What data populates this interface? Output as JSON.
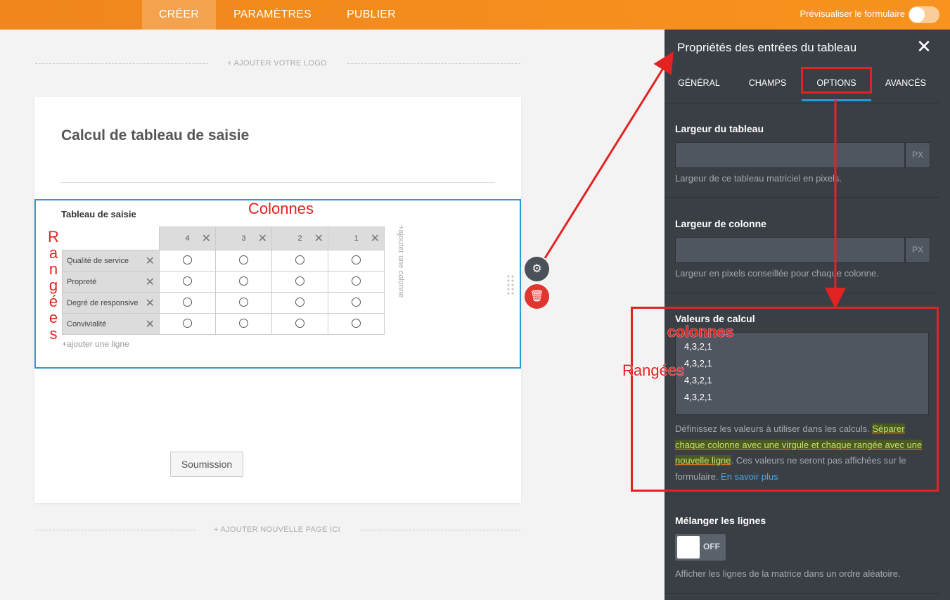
{
  "topbar": {
    "tabs": [
      "CRÉER",
      "PARAMÈTRES",
      "PUBLIER"
    ],
    "preview_label": "Prévisualiser le formulaire"
  },
  "canvas": {
    "add_logo": "+ AJOUTER VOTRE LOGO",
    "form_title": "Calcul de tableau de saisie",
    "field_label": "Tableau de saisie",
    "columns": [
      "4",
      "3",
      "2",
      "1"
    ],
    "rows": [
      "Qualité de service",
      "Propreté",
      "Degré de responsive",
      "Convivialité"
    ],
    "add_row": "+ajouter une ligne",
    "add_column": "+ajouter une colonne",
    "submit_label": "Soumission",
    "add_page": "+ AJOUTER NOUVELLE PAGE ICI"
  },
  "annotations": {
    "colonnes": "Colonnes",
    "rangees_vertical": [
      "R",
      "a",
      "n",
      "g",
      "é",
      "e",
      "s"
    ],
    "colonnes2": "colonnes",
    "rangees2": "Rangées",
    "color": "#e32222"
  },
  "panel": {
    "title": "Propriétés des entrées du tableau",
    "tabs": [
      "GÉNÉRAL",
      "CHAMPS",
      "OPTIONS",
      "AVANCÉS"
    ],
    "active_tab": "OPTIONS",
    "table_width": {
      "label": "Largeur du tableau",
      "value": "",
      "unit": "PX",
      "help": "Largeur de ce tableau matriciel en pixels."
    },
    "column_width": {
      "label": "Largeur de colonne",
      "value": "",
      "unit": "PX",
      "help": "Largeur en pixels conseillée pour chaque colonne."
    },
    "calc_values": {
      "label": "Valeurs de calcul",
      "lines": [
        "4,3,2,1",
        "4,3,2,1",
        "4,3,2,1",
        "4,3,2,1"
      ],
      "help_pre": "Définissez les valeurs à utiliser dans les calculs. ",
      "help_highlight": "Séparer chaque colonne avec une virgule et chaque rangée avec une nouvelle ligne",
      "help_post": ". Ces valeurs ne seront pas affichées sur le formulaire. ",
      "help_link": "En savoir plus"
    },
    "shuffle": {
      "label": "Mélanger les lignes",
      "state": "OFF",
      "help": "Afficher les lignes de la matrice dans un ordre aléatoire."
    }
  },
  "colors": {
    "brand_orange": "#f7931e",
    "panel_bg": "#3a3e45",
    "accent_blue": "#2b9ad6",
    "delete_red": "#e2352f"
  }
}
